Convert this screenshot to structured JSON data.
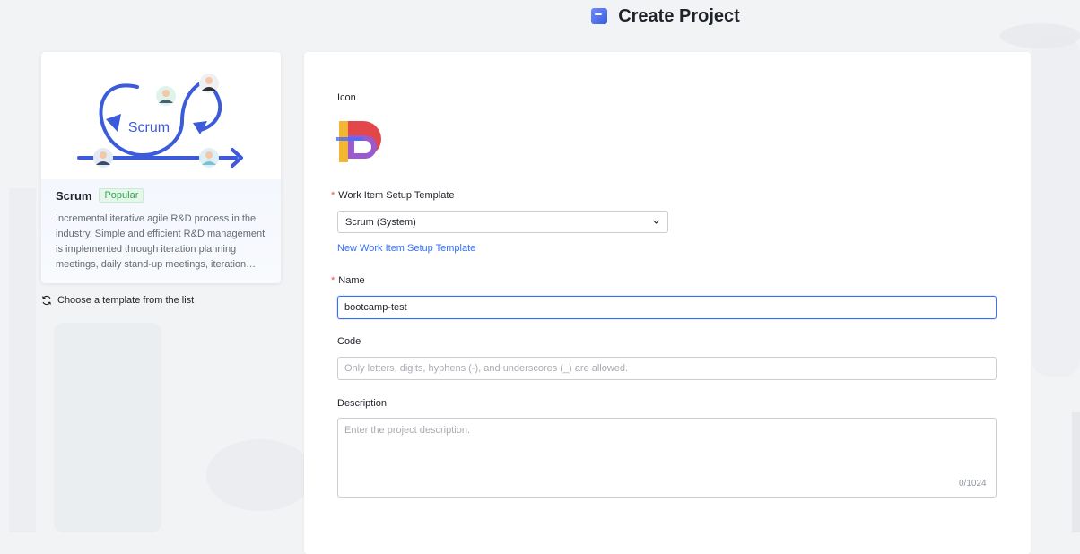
{
  "header": {
    "title": "Create Project",
    "icon": "project-icon"
  },
  "template_card": {
    "name": "Scrum",
    "badge": "Popular",
    "illustration_text": "Scrum",
    "description": "Incremental iterative agile R&D process in the industry. Simple and efficient R&D management is implemented through iteration planning meetings, daily stand-up meetings, iteration review meetings, and iteration retrospective meetings."
  },
  "choose_template": {
    "label": "Choose a template from the list",
    "icon": "refresh-icon"
  },
  "form": {
    "icon_label": "Icon",
    "work_item_template": {
      "label": "Work Item Setup Template",
      "required": "*",
      "value": "Scrum (System)"
    },
    "new_template_link": "New Work Item Setup Template",
    "name": {
      "label": "Name",
      "required": "*",
      "value": "bootcamp-test"
    },
    "code": {
      "label": "Code",
      "placeholder": "Only letters, digits, hyphens (-), and underscores (_) are allowed."
    },
    "description": {
      "label": "Description",
      "placeholder": "Enter the project description.",
      "counter": "0/1024"
    }
  },
  "colors": {
    "accent": "#3370ff",
    "required": "#f54a45",
    "badge_green": "#2ea44f",
    "scrum_blue": "#3b5bdb"
  }
}
